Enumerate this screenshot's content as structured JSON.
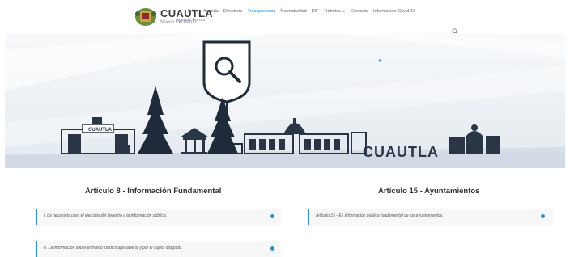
{
  "header": {
    "brand": "CUAUTLA",
    "brand_sub": "Nuevo Fecuerdo",
    "overlap_text": "Agenda Forum",
    "nav": [
      "Inicio",
      "Agenda",
      "Directorio",
      "Transparencia",
      "Normatividad",
      "DIF",
      "Trámites ⌄",
      "Contacto",
      "Información Covid-19"
    ],
    "active_nav": "Transparencia"
  },
  "hero": {
    "town_name": "CUAUTLA",
    "arch_sign": "CUAUTLA",
    "badge_icon": "search-icon"
  },
  "sections": [
    {
      "title": "Artículo 8 - Información Fundamental",
      "items": [
        "I. La necesaria para el ejercicio del derecho a la información pública.",
        "II. La información sobre el marco jurídico aplicable al y por el sujeto obligado."
      ]
    },
    {
      "title": "Artículo 15 - Ayuntamientos",
      "items": [
        "Artículo 15 - Es información pública fundamental de los ayuntamientos."
      ]
    }
  ],
  "colors": {
    "accent": "#1e88c9",
    "item_border": "#2a8fd0",
    "hero_dark": "#1f2a3a"
  }
}
